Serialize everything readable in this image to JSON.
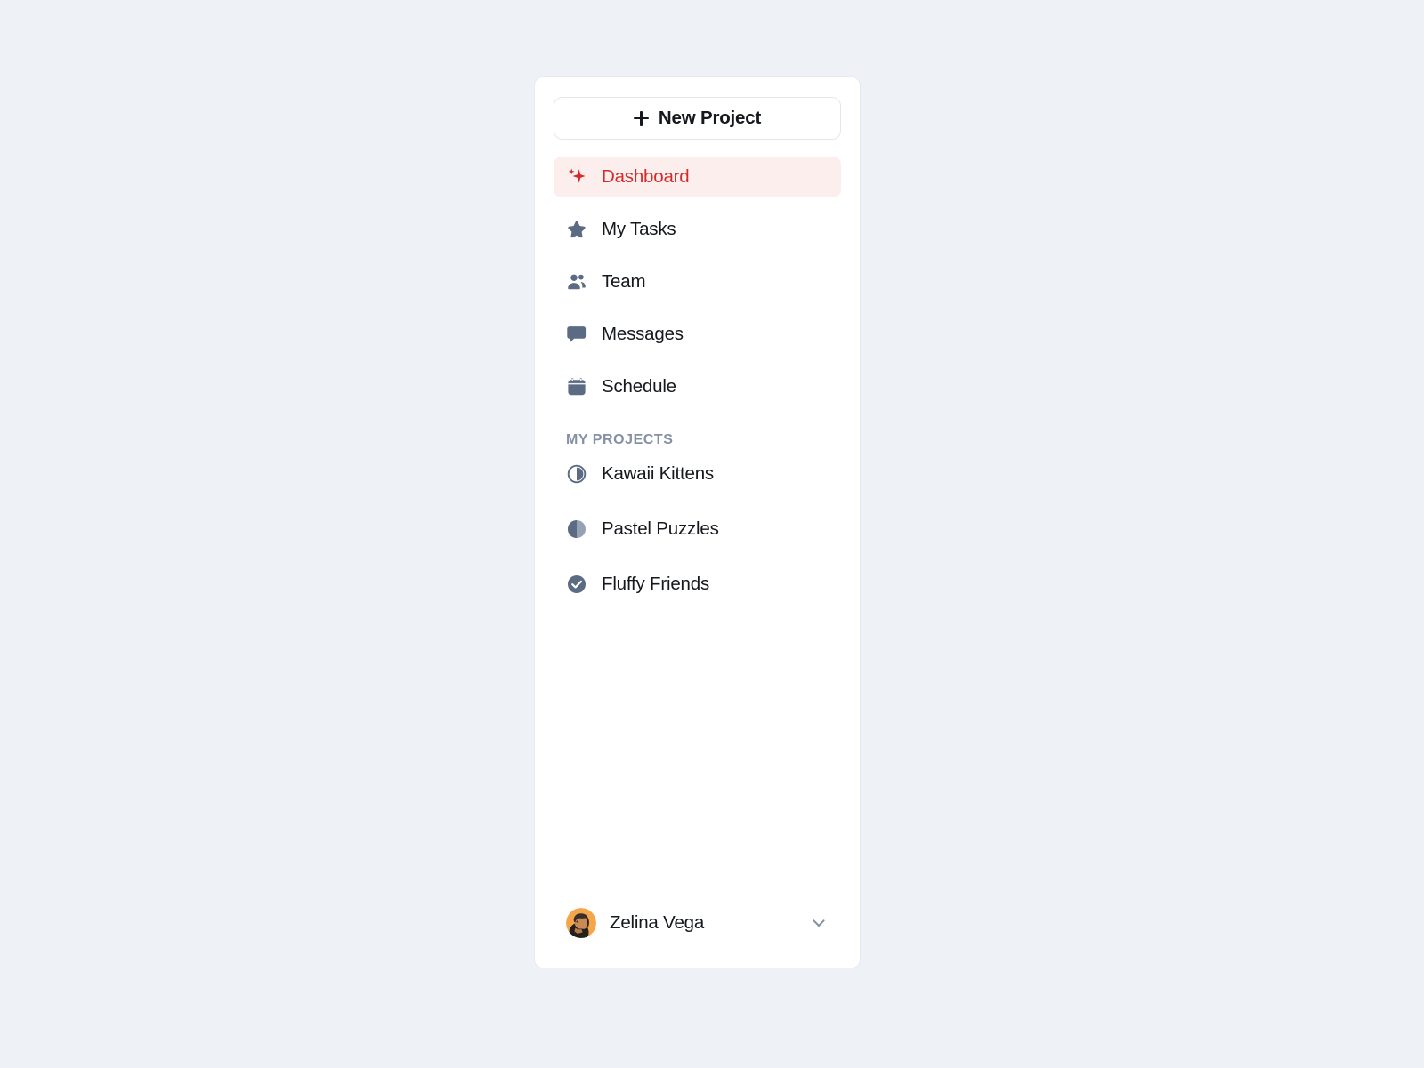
{
  "theme": {
    "page_background": "#eef1f6",
    "card_background": "#ffffff",
    "card_border": "#e6e9ef",
    "text_primary": "#15181d",
    "icon_slate": "#5c6b84",
    "muted_label": "#8690a5",
    "accent_red": "#d42a2a",
    "accent_red_bg": "#fdeeee",
    "avatar_bg": "#f5a64a"
  },
  "sidebar": {
    "new_project": {
      "label": "New Project",
      "icon": "plus-icon"
    },
    "nav_items": [
      {
        "label": "Dashboard",
        "icon": "sparkle-icon",
        "active": true
      },
      {
        "label": "My Tasks",
        "icon": "star-icon",
        "active": false
      },
      {
        "label": "Team",
        "icon": "people-icon",
        "active": false
      },
      {
        "label": "Messages",
        "icon": "chat-bubble-icon",
        "active": false
      },
      {
        "label": "Schedule",
        "icon": "calendar-icon",
        "active": false
      }
    ],
    "projects_heading": "MY PROJECTS",
    "projects": [
      {
        "label": "Kawaii Kittens",
        "icon": "progress-half-outline-icon"
      },
      {
        "label": "Pastel Puzzles",
        "icon": "progress-half-filled-icon"
      },
      {
        "label": "Fluffy Friends",
        "icon": "check-circle-icon"
      }
    ],
    "user": {
      "name": "Zelina Vega",
      "avatar": "user-avatar",
      "chevron": "chevron-down-icon"
    }
  }
}
